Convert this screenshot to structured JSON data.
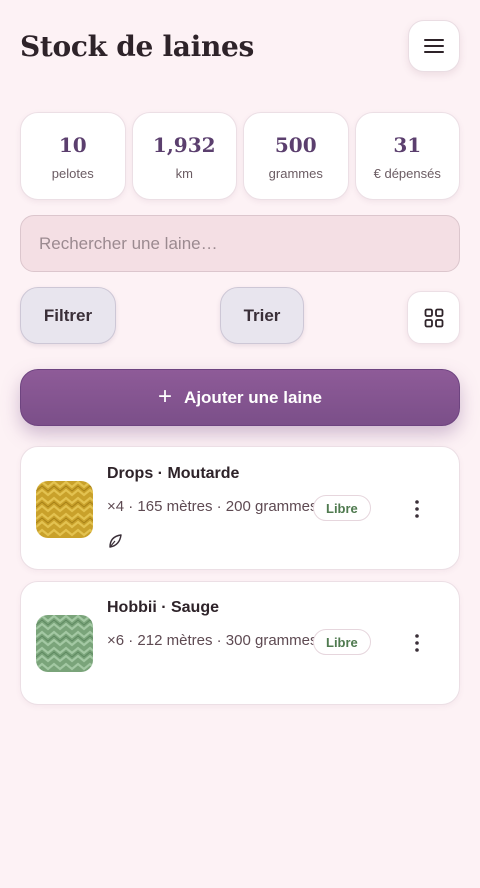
{
  "header": {
    "title": "Stock de laines",
    "menu_icon": "menu-icon"
  },
  "stats": [
    {
      "value": "10",
      "label": "pelotes"
    },
    {
      "value": "1,932",
      "label": "km"
    },
    {
      "value": "500",
      "label": "grammes"
    },
    {
      "value": "31",
      "label": "€ dépensés"
    }
  ],
  "search": {
    "placeholder": "Rechercher une laine…"
  },
  "controls": {
    "filter_label": "Filtrer",
    "sort_label": "Trier",
    "view_icon": "grid-view-icon"
  },
  "add_button": {
    "label": "Ajouter une laine",
    "icon": "plus-icon"
  },
  "yarns": [
    {
      "name": "Drops · Moutarde",
      "meta": "×4 · 165 mètres · 200 grammes",
      "status": "Libre",
      "swatch_colors": [
        "#c9a12b",
        "#e0bd44",
        "#a88218"
      ],
      "has_note_icon": true
    },
    {
      "name": "Hobbii · Sauge",
      "meta": "×6 · 212 mètres · 300 grammes",
      "status": "Libre",
      "swatch_colors": [
        "#7aa47a",
        "#9bc29b",
        "#5f8a62"
      ],
      "has_note_icon": false
    }
  ],
  "colors": {
    "accent": "#7b4f89",
    "background": "#fdf2f5",
    "status_free": "#4f7a4f"
  }
}
